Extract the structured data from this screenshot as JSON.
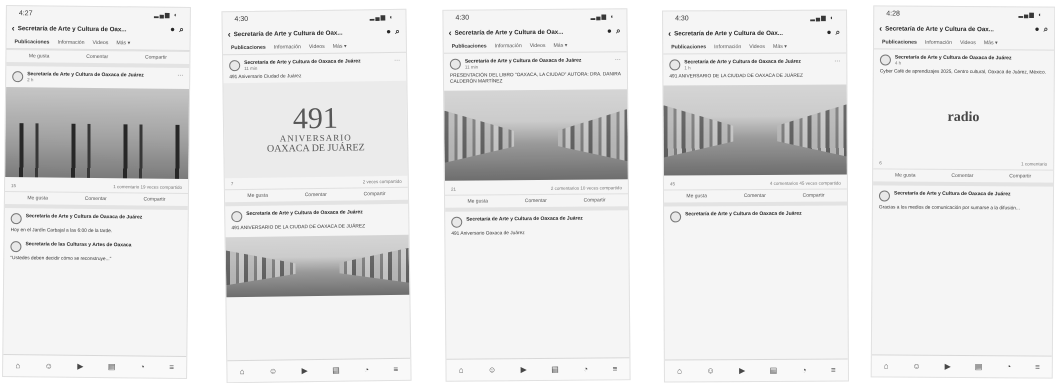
{
  "page_title": "Secretaría de Arte y Cultura de Oax...",
  "tabs": [
    "Publicaciones",
    "Información",
    "Videos",
    "Más ▾"
  ],
  "author": "Secretaría de Arte y Cultura de Oaxaca de Juárez",
  "actions": [
    "Me gusta",
    "Comentar",
    "Compartir"
  ],
  "screens": [
    {
      "time": "4:27",
      "post1_text": "",
      "post1_time": "2 h",
      "stats_left": "15",
      "stats_right": "1 comentario  19 veces compartido",
      "post2_author": "Secretaría de Arte y Cultura de Oaxaca de Juárez",
      "post2_text": "Hoy en el Jardín Carbajal a las 6:00 de la tarde.",
      "post3_author": "Secretaría de las Culturas y Artes de Oaxaca",
      "post3_text": "\"Ustedes deben decidir cómo se reconstruye...\""
    },
    {
      "time": "4:30",
      "post1_text": "491 Aniversario Ciudad de Juárez",
      "post1_time": "11 min",
      "anniv_num": "491",
      "anniv_word": "ANIVERSARIO",
      "anniv_city": "OAXACA DE JUÁREZ",
      "stats_left": "7",
      "stats_right": "2 veces compartido",
      "post2_text": "491 ANIVERSARIO DE LA CIUDAD DE OAXACA DE JUÁREZ"
    },
    {
      "time": "4:30",
      "post1_text": "PRESENTACIÓN DEL LIBRO \"OAXACA, LA CIUDAD\" AUTORA: DRA. DANIRA CALDERÓN MARTÍNEZ",
      "post1_time": "11 min",
      "stats_left": "21",
      "stats_right": "2 comentarios  10 veces compartido",
      "post2_text": "491 Aniversario Oaxaca de Juárez"
    },
    {
      "time": "4:30",
      "post1_text": "491 ANIVERSARIO DE LA CIUDAD DE OAXACA DE JUÁREZ",
      "post1_time": "1 h",
      "stats_left": "45",
      "stats_right": "4 comentarios  45 veces compartido",
      "post2_text": "Secretaría de Arte y Cultura de Oaxaca de Juárez"
    },
    {
      "time": "4:28",
      "post1_text": "Cyber Café de aprendizajes 2025, Centro cultural, Oaxaca de Juárez, México.",
      "post1_time": "4 h",
      "logo_text": "radio",
      "stats_left": "6",
      "stats_right": "1 comentario",
      "post2_text": "Gracias a los medios de comunicación por sumarse a la difusión..."
    }
  ],
  "nav_icons": [
    "home-icon",
    "friends-icon",
    "video-icon",
    "marketplace-icon",
    "notifications-icon",
    "menu-icon"
  ]
}
